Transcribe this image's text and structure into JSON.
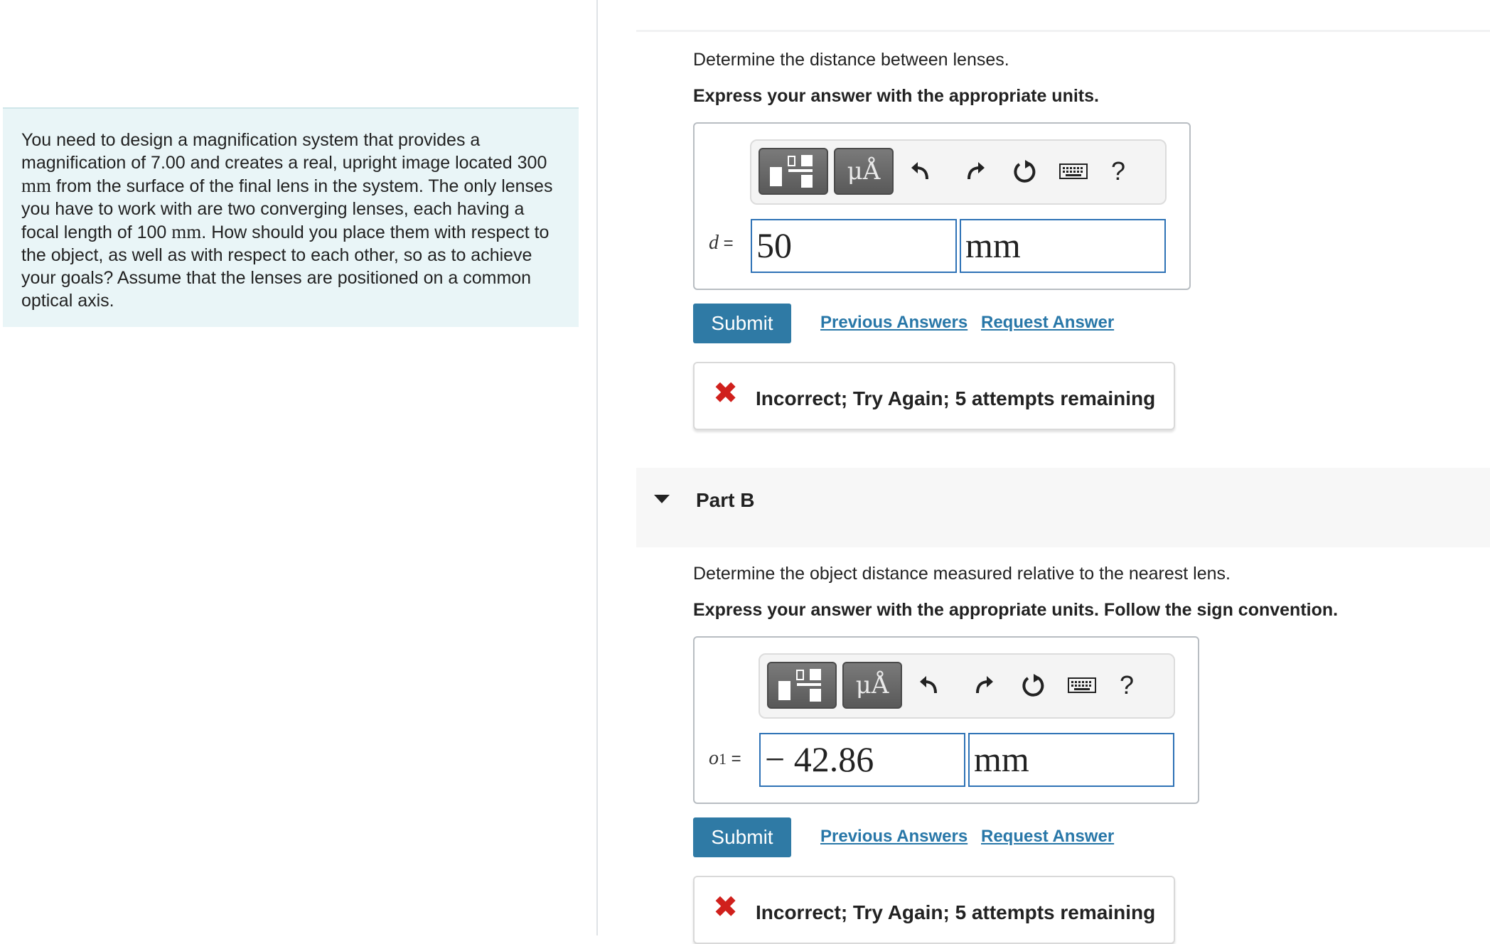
{
  "problem": {
    "segments": [
      "You need to design a magnification system that provides a magnification of 7.00 and creates a real, upright image located 300 ",
      "mm",
      " from the surface of the final lens in the system. The only lenses you have to work with are two converging lenses, each having a focal length of 100 ",
      "mm",
      ". How should you place them with respect to the object, as well as with respect to each other, so as to achieve your goals? Assume that the lenses are positioned on a common optical axis."
    ]
  },
  "partA": {
    "prompt": "Determine the distance between lenses.",
    "instruction": "Express your answer with the appropriate units.",
    "toolbar": {
      "mu_label": "μÅ",
      "help_label": "?"
    },
    "variable": "d",
    "equals": " =",
    "value": "50",
    "unit": "mm",
    "submit_label": "Submit",
    "previous_answers_label": "Previous Answers",
    "request_answer_label": "Request Answer",
    "feedback_icon": "✖",
    "feedback": "Incorrect; Try Again; 5 attempts remaining"
  },
  "partB": {
    "title": "Part B",
    "prompt": "Determine the object distance measured relative to the nearest lens.",
    "instruction": "Express your answer with the appropriate units. Follow the sign convention.",
    "toolbar": {
      "mu_label": "μÅ",
      "help_label": "?"
    },
    "variable": "o",
    "subscript": "1",
    "equals": " =",
    "value": "− 42.86",
    "unit": "mm",
    "submit_label": "Submit",
    "previous_answers_label": "Previous Answers",
    "request_answer_label": "Request Answer",
    "feedback_icon": "✖",
    "feedback": "Incorrect; Try Again; 5 attempts remaining"
  },
  "icons": {
    "undo": "undo-icon",
    "redo": "redo-icon",
    "reset": "reset-icon",
    "keyboard": "keyboard-icon",
    "help": "help-icon",
    "fraction": "fraction-template-icon",
    "incorrect": "incorrect-x-icon",
    "collapse": "collapse-caret-icon"
  },
  "colors": {
    "submit": "#2f7aa5",
    "link": "#2877a8",
    "field_border": "#2e72b6",
    "error": "#d0201c",
    "problem_bg": "#e9f5f7"
  }
}
